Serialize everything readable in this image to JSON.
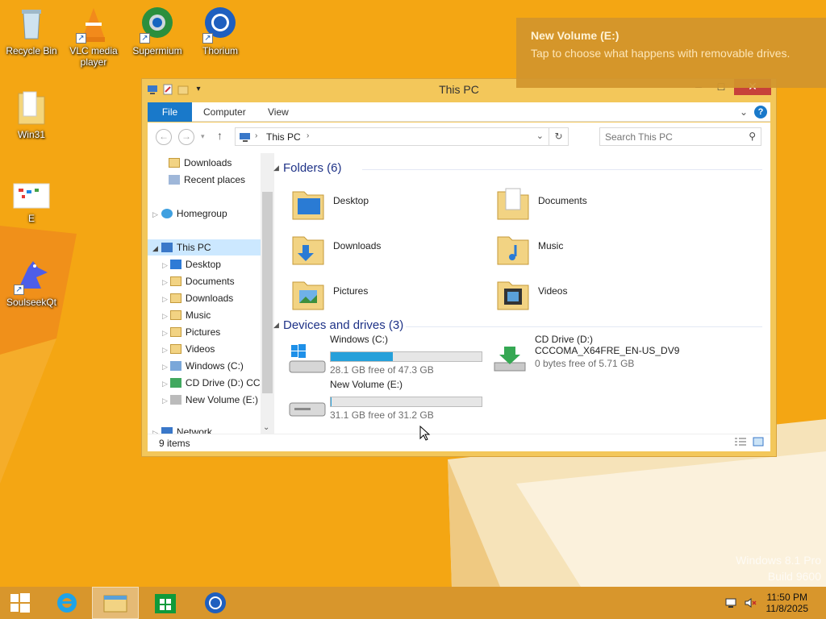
{
  "desktop": {
    "icons": [
      {
        "label": "Recycle Bin",
        "icon": "recycle-bin-icon"
      },
      {
        "label": "VLC media player",
        "icon": "vlc-icon"
      },
      {
        "label": "Supermium",
        "icon": "supermium-icon"
      },
      {
        "label": "Thorium",
        "icon": "thorium-icon"
      },
      {
        "label": "Win31",
        "icon": "folder-icon"
      },
      {
        "label": "E",
        "icon": "file-icon"
      },
      {
        "label": "SoulseekQt",
        "icon": "soulseek-icon"
      }
    ],
    "watermark": {
      "line1": "Windows 8.1 Pro",
      "line2": "Build 9600"
    }
  },
  "toast": {
    "title": "New Volume (E:)",
    "message": "Tap to choose what happens with removable drives."
  },
  "window": {
    "title": "This PC",
    "ribbon_tabs": [
      "File",
      "Computer",
      "View"
    ],
    "address": {
      "location": "This PC"
    },
    "search": {
      "placeholder": "Search This PC"
    },
    "nav": {
      "quick": [
        "Downloads",
        "Recent places"
      ],
      "homegroup": "Homegroup",
      "this_pc": "This PC",
      "children": [
        "Desktop",
        "Documents",
        "Downloads",
        "Music",
        "Pictures",
        "Videos",
        "Windows (C:)",
        "CD Drive (D:) CCC",
        "New Volume (E:)"
      ],
      "network": "Network"
    },
    "folders_header": "Folders (6)",
    "folders": [
      "Desktop",
      "Documents",
      "Downloads",
      "Music",
      "Pictures",
      "Videos"
    ],
    "devices_header": "Devices and drives (3)",
    "drives": [
      {
        "name": "Windows (C:)",
        "free": "28.1 GB free of 47.3 GB",
        "used_fraction": 0.41
      },
      {
        "name": "CD Drive (D:)",
        "label": "CCCOMA_X64FRE_EN-US_DV9",
        "free": "0 bytes free of 5.71 GB"
      },
      {
        "name": "New Volume (E:)",
        "free": "31.1 GB free of 31.2 GB",
        "used_fraction": 0.003
      }
    ],
    "status": "9 items"
  },
  "taskbar": {
    "clock_time": "11:50 PM",
    "clock_date": "11/8/2025"
  },
  "colors": {
    "accent": "#1979ca",
    "wallpaper": "#f3a512",
    "bar_fill": "#26a0da"
  }
}
